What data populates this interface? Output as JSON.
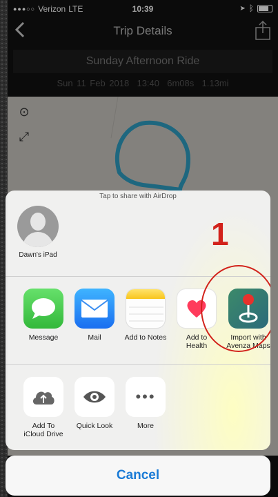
{
  "status_bar": {
    "carrier": "Verizon",
    "network": "LTE",
    "time": "10:39"
  },
  "nav": {
    "title": "Trip Details"
  },
  "ride": {
    "name": "Sunday Afternoon Ride",
    "date": "Sun 11 Feb 2018",
    "start_time": "13:40",
    "duration": "6m08s",
    "distance": "1.13mi"
  },
  "share_sheet": {
    "airdrop_hint": "Tap to share with AirDrop",
    "airdrop_contact": "Dawn's iPad",
    "annotation_number": "1",
    "apps": [
      {
        "label": "Message",
        "icon": "message-icon"
      },
      {
        "label": "Mail",
        "icon": "mail-icon"
      },
      {
        "label": "Add to Notes",
        "icon": "notes-icon"
      },
      {
        "label": "Add to\nHealth",
        "icon": "health-icon"
      },
      {
        "label": "Import with\nAvenza Maps",
        "icon": "avenza-maps-icon"
      }
    ],
    "actions": [
      {
        "label": "Add To\niCloud Drive",
        "icon": "icloud-upload-icon"
      },
      {
        "label": "Quick Look",
        "icon": "eye-icon"
      },
      {
        "label": "More",
        "icon": "more-icon"
      }
    ],
    "cancel_label": "Cancel"
  },
  "colors": {
    "route": "#2f9fc4",
    "annotation": "#d2221b",
    "cancel_text": "#1a7bd6"
  }
}
